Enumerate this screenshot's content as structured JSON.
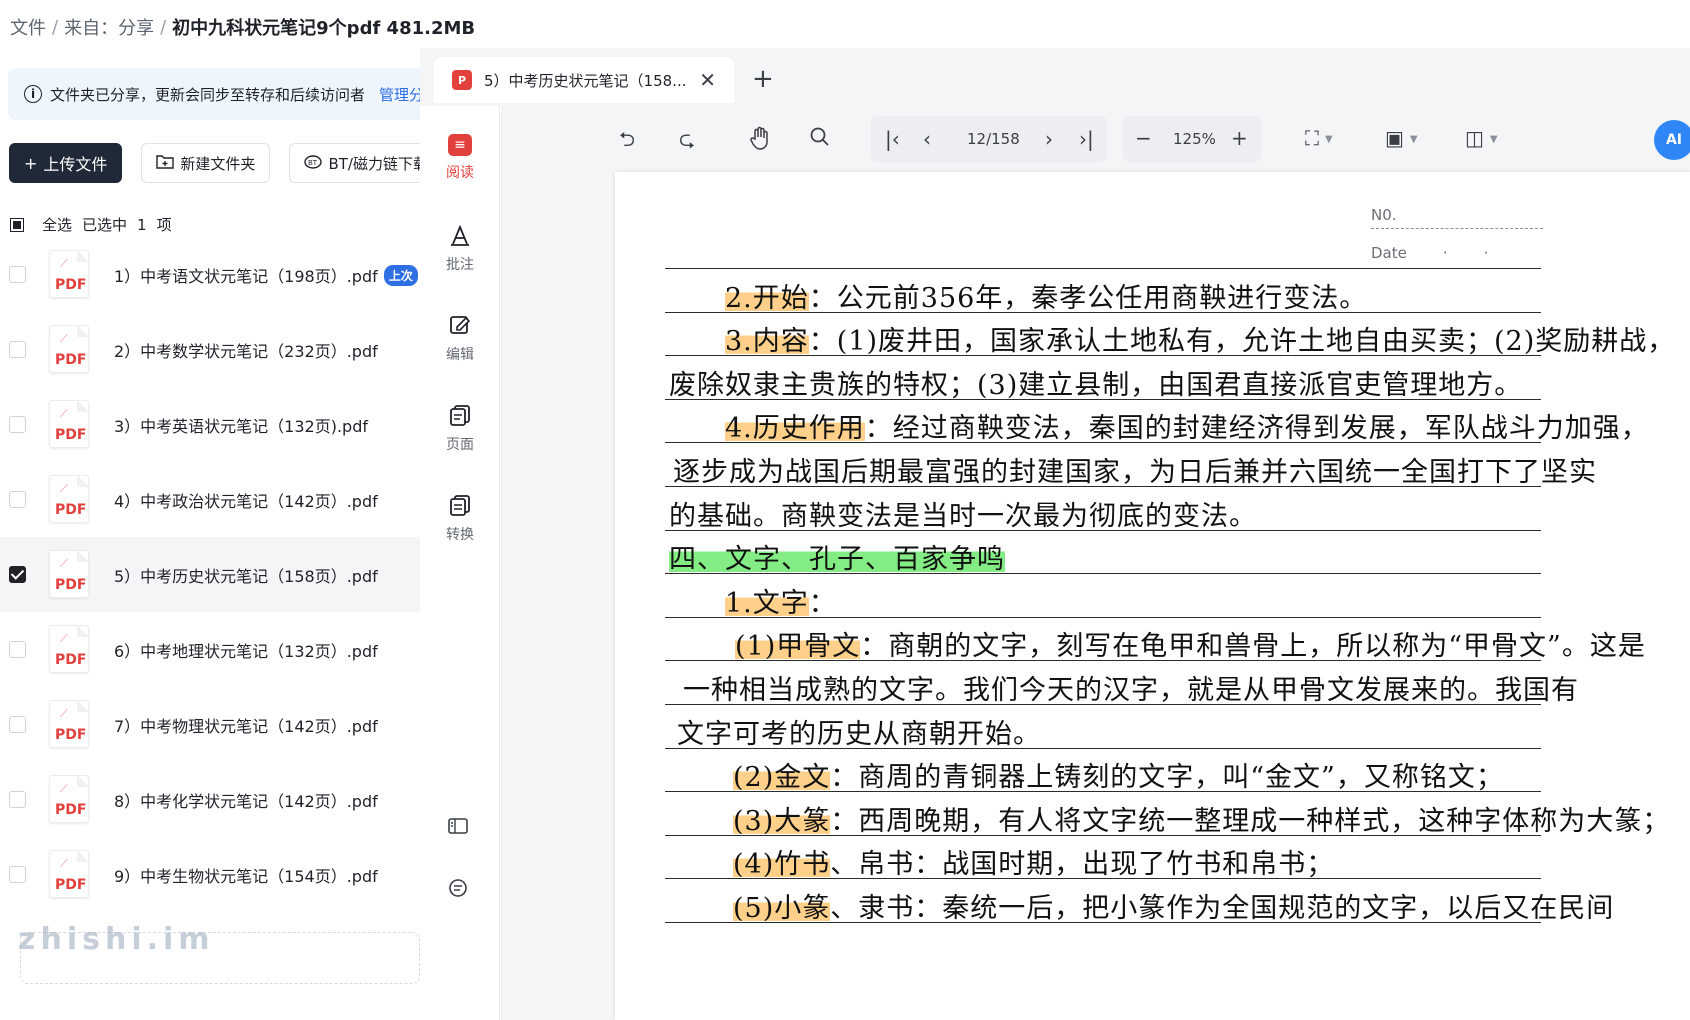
{
  "breadcrumb": {
    "items": [
      "文件",
      "来自：分享"
    ],
    "current": "初中九科状元笔记9个pdf 481.2MB"
  },
  "banner": {
    "text": "文件夹已分享，更新会同步至转存和后续访问者",
    "link": "管理分"
  },
  "buttons": {
    "upload": "上传文件",
    "new_folder": "新建文件夹",
    "bt": "BT/磁力链下载"
  },
  "selection": {
    "select_all": "全选",
    "selected_prefix": "已选中",
    "selected_count": "1",
    "selected_suffix": "项"
  },
  "files": [
    {
      "name": "1）中考语文状元笔记（198页）.pdf",
      "tag": "上次",
      "checked": false
    },
    {
      "name": "2）中考数学状元笔记（232页）.pdf",
      "checked": false
    },
    {
      "name": "3）中考英语状元笔记（132页).pdf",
      "checked": false
    },
    {
      "name": "4）中考政治状元笔记（142页）.pdf",
      "checked": false
    },
    {
      "name": "5）中考历史状元笔记（158页）.pdf",
      "checked": true
    },
    {
      "name": "6）中考地理状元笔记（132页）.pdf",
      "checked": false
    },
    {
      "name": "7）中考物理状元笔记（142页）.pdf",
      "checked": false
    },
    {
      "name": "8）中考化学状元笔记（142页）.pdf",
      "checked": false
    },
    {
      "name": "9）中考生物状元笔记（154页）.pdf",
      "checked": false
    }
  ],
  "pdf_icon_label": "PDF",
  "watermark": "zhishi.im",
  "viewer": {
    "tab_title": "5）中考历史状元笔记（158...",
    "tab_icon_label": "PDF",
    "sidebar": [
      {
        "label": "阅读",
        "icon": "read-icon",
        "active": true
      },
      {
        "label": "批注",
        "icon": "annotate-icon",
        "active": false
      },
      {
        "label": "编辑",
        "icon": "edit-icon",
        "active": false
      },
      {
        "label": "页面",
        "icon": "pages-icon",
        "active": false
      },
      {
        "label": "转换",
        "icon": "convert-icon",
        "active": false
      }
    ],
    "page_indicator": "12/158",
    "zoom": "125%",
    "ai_label": "AI"
  },
  "page": {
    "no_label": "N0.",
    "date_label": "Date",
    "lines": [
      {
        "hl": "2.开始",
        "text": "：公元前356年，秦孝公任用商鞅进行变法。"
      },
      {
        "hl": "3.内容",
        "text": "：(1)废井田，国家承认土地私有，允许土地自由买卖；(2)奖励耕战，"
      },
      {
        "hl": "",
        "text": "废除奴隶主贵族的特权；(3)建立县制，由国君直接派官吏管理地方。"
      },
      {
        "hl": "4.历史作用",
        "text": "：经过商鞅变法，秦国的封建经济得到发展，军队战斗力加强，"
      },
      {
        "hl": "",
        "text": "逐步成为战国后期最富强的封建国家，为日后兼并六国统一全国打下了坚实"
      },
      {
        "hl": "",
        "text": "的基础。商鞅变法是当时一次最为彻底的变法。"
      },
      {
        "hl": "",
        "green": "四、文字、孔子、百家争鸣",
        "text": ""
      },
      {
        "hl": "1.文字",
        "text": "："
      },
      {
        "hl": "(1)甲骨文",
        "text": "：商朝的文字，刻写在龟甲和兽骨上，所以称为“甲骨文”。这是"
      },
      {
        "hl": "",
        "text": "一种相当成熟的文字。我们今天的汉字，就是从甲骨文发展来的。我国有"
      },
      {
        "hl": "",
        "text": "文字可考的历史从商朝开始。"
      },
      {
        "hl": "(2)金文",
        "text": "：商周的青铜器上铸刻的文字，叫“金文”，又称铭文；"
      },
      {
        "hl": "(3)大篆",
        "text": "：西周晚期，有人将文字统一整理成一种样式，这种字体称为大篆；"
      },
      {
        "hl": "(4)竹书",
        "text": "、帛书：战国时期，出现了竹书和帛书；"
      },
      {
        "hl": "(5)小篆",
        "text": "、隶书：秦统一后，把小篆作为全国规范的文字，以后又在民间"
      }
    ]
  }
}
